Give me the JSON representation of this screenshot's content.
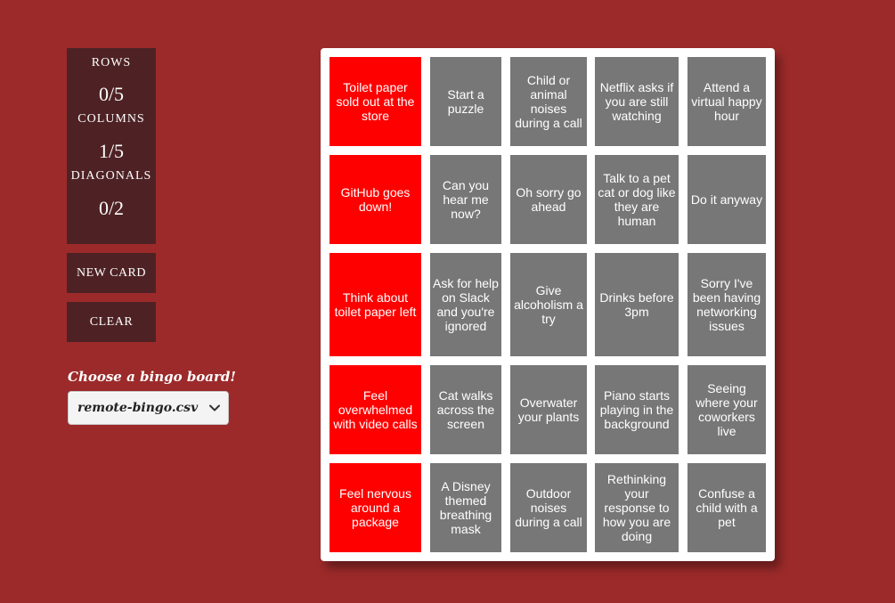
{
  "scoreboard": {
    "rows_label": "ROWS",
    "rows_value": "0/5",
    "columns_label": "COLUMNS",
    "columns_value": "1/5",
    "diagonals_label": "DIAGONALS",
    "diagonals_value": "0/2"
  },
  "buttons": {
    "new_card": "NEW CARD",
    "clear": "CLEAR"
  },
  "board_picker": {
    "label": "Choose a bingo board!",
    "selected": "remote-bingo.csv"
  },
  "colors": {
    "background": "#9c2a2a",
    "panel": "#4e2224",
    "marked": "#ff0000",
    "unmarked": "#777777"
  },
  "board": {
    "cells": [
      [
        {
          "text": "Toilet paper sold out at the store",
          "marked": true
        },
        {
          "text": "Start a puzzle",
          "marked": false
        },
        {
          "text": "Child or animal noises during a call",
          "marked": false
        },
        {
          "text": "Netflix asks if you are still watching",
          "marked": false
        },
        {
          "text": "Attend a virtual happy hour",
          "marked": false
        }
      ],
      [
        {
          "text": "GitHub goes down!",
          "marked": true
        },
        {
          "text": "Can you hear me now?",
          "marked": false
        },
        {
          "text": "Oh sorry go ahead",
          "marked": false
        },
        {
          "text": "Talk to a pet cat or dog like they are human",
          "marked": false
        },
        {
          "text": "Do it anyway",
          "marked": false
        }
      ],
      [
        {
          "text": "Think about toilet paper left",
          "marked": true
        },
        {
          "text": "Ask for help on Slack and you're ignored",
          "marked": false
        },
        {
          "text": "Give alcoholism a try",
          "marked": false
        },
        {
          "text": "Drinks before 3pm",
          "marked": false
        },
        {
          "text": "Sorry I've been having networking issues",
          "marked": false
        }
      ],
      [
        {
          "text": "Feel overwhelmed with video calls",
          "marked": true
        },
        {
          "text": "Cat walks across the screen",
          "marked": false
        },
        {
          "text": "Overwater your plants",
          "marked": false
        },
        {
          "text": "Piano starts playing in the background",
          "marked": false
        },
        {
          "text": "Seeing where your coworkers live",
          "marked": false
        }
      ],
      [
        {
          "text": "Feel nervous around a package",
          "marked": true
        },
        {
          "text": "A Disney themed breathing mask",
          "marked": false
        },
        {
          "text": "Outdoor noises during a call",
          "marked": false
        },
        {
          "text": "Rethinking your response to how you are doing",
          "marked": false
        },
        {
          "text": "Confuse a child with a pet",
          "marked": false
        }
      ]
    ]
  }
}
